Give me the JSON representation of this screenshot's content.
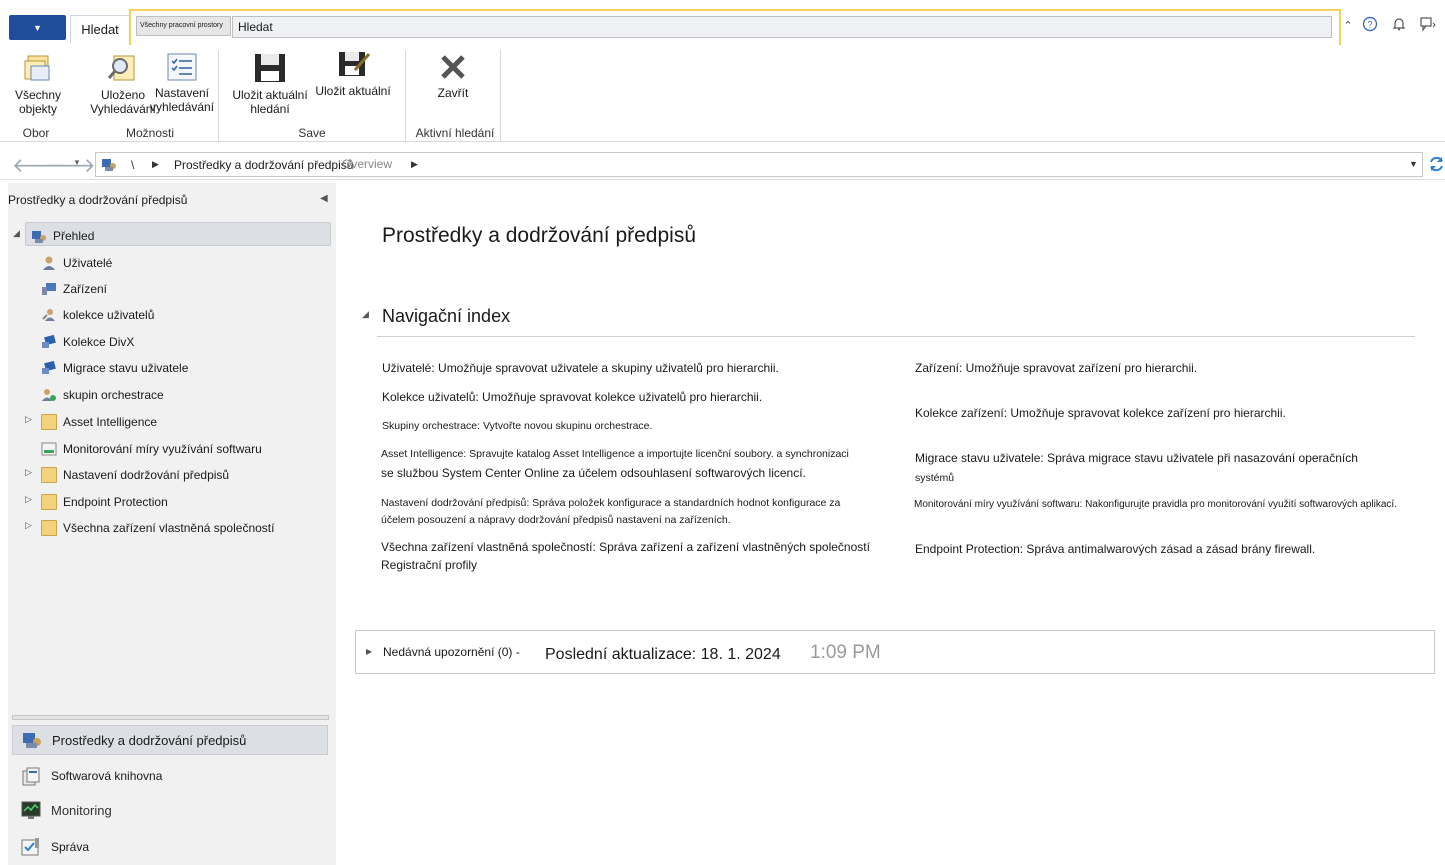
{
  "topbar": {
    "search_tab": "Hledat",
    "scope": "Všechny pracovní prostory",
    "search_value": "Hledat"
  },
  "ribbon": {
    "btn_all_objects": "Všechny objekty",
    "btn_saved_search": "Uloženo Vyhledávání",
    "btn_search_settings": "Nastavení vyhledávání",
    "btn_save_current": "Uložit aktuální hledání",
    "btn_save_current_as": "Uložit aktuální",
    "btn_close": "Zavřít",
    "group_scope": "Obor",
    "group_options": "Možnosti",
    "group_save": "Save",
    "group_active": "Aktivní hledání"
  },
  "address": {
    "root": "\\",
    "path": "Prostředky a dodržování předpisů",
    "overlay": "Overview"
  },
  "leftnav": {
    "title": "Prostředky a dodržování předpisů",
    "items": [
      {
        "label": "Přehled"
      },
      {
        "label": "Uživatelé"
      },
      {
        "label": "Zařízení"
      },
      {
        "label": "kolekce uživatelů"
      },
      {
        "label": "Kolekce DivX"
      },
      {
        "label": "Migrace stavu uživatele"
      },
      {
        "label": "skupin orchestrace"
      },
      {
        "label": "Asset Intelligence"
      },
      {
        "label": "Monitorování míry využívání softwaru"
      },
      {
        "label": "Nastavení dodržování předpisů"
      },
      {
        "label": "Endpoint Protection"
      },
      {
        "label": "Všechna zařízení vlastněná společností"
      }
    ],
    "workspaces": [
      {
        "label": "Prostředky a dodržování předpisů"
      },
      {
        "label": "Softwarová knihovna"
      },
      {
        "label": "Monitoring"
      },
      {
        "label": "Správa"
      }
    ]
  },
  "content": {
    "title": "Prostředky a dodržování předpisů",
    "section": "Navigační index",
    "left": [
      "Uživatelé: Umožňuje spravovat uživatele a skupiny uživatelů pro hierarchii.",
      "Kolekce uživatelů: Umožňuje spravovat kolekce uživatelů pro hierarchii.",
      "Skupiny orchestrace: Vytvořte novou skupinu orchestrace.",
      "Asset Intelligence: Spravujte katalog Asset Intelligence a importujte licenční soubory. a synchronizaci",
      "se službou System Center Online za účelem odsouhlasení softwarových licencí.",
      "Nastavení dodržování předpisů: Správa položek konfigurace a standardních hodnot konfigurace za",
      "účelem posouzení a nápravy dodržování předpisů nastavení na zařízeních.",
      "Všechna zařízení vlastněná společností: Správa zařízení a zařízení vlastněných společností",
      "Registrační profily"
    ],
    "right": [
      "Zařízení: Umožňuje spravovat zařízení pro hierarchii.",
      "Kolekce zařízení: Umožňuje spravovat kolekce zařízení pro hierarchii.",
      "Migrace stavu uživatele: Správa migrace stavu uživatele při nasazování operačních",
      "systémů",
      "Monitorování míry využívání softwaru: Nakonfigurujte pravidla pro monitorování využití softwarových aplikací.",
      "Endpoint Protection: Správa antimalwarových zásad a zásad brány firewall."
    ],
    "alerts_label": "Nedávná upozornění (0) -",
    "last_update": "Poslední aktualizace: 18. 1. 2024",
    "last_update_ghost": "1:09 PM"
  }
}
